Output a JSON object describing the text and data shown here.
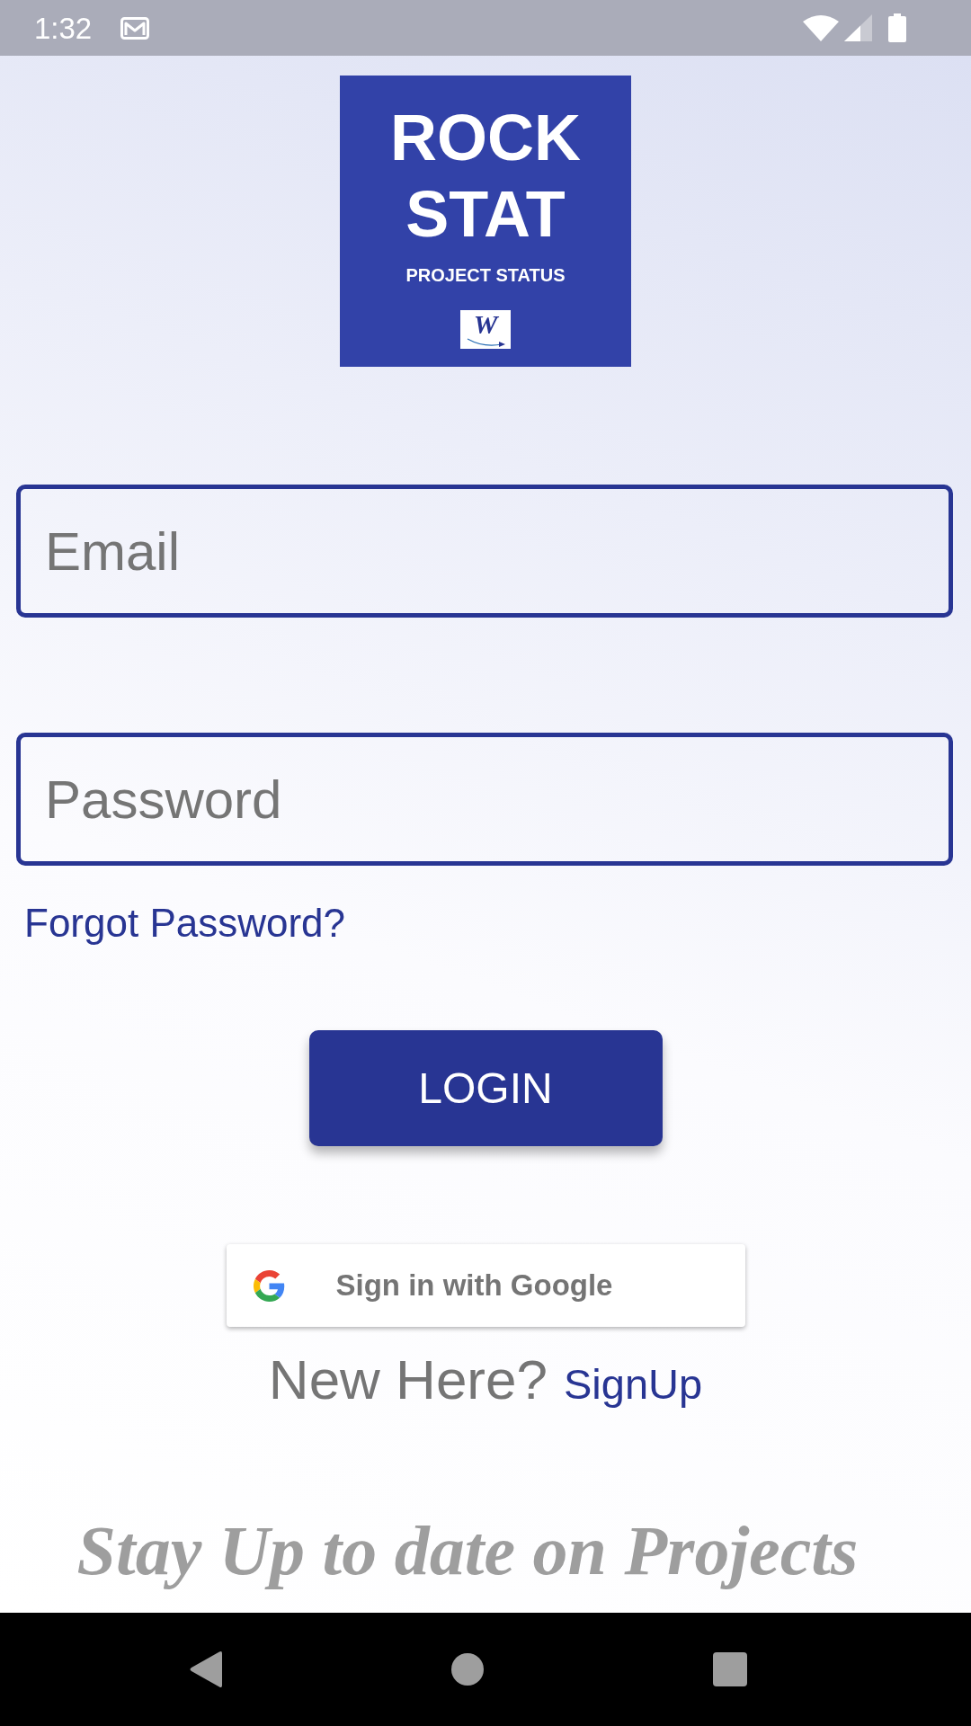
{
  "status_bar": {
    "time": "1:32"
  },
  "logo": {
    "title_lines": [
      "ROCK",
      "STAT"
    ],
    "subtitle": "PROJECT STATUS",
    "mark_letter": "W"
  },
  "fields": [
    {
      "placeholder": "Email"
    },
    {
      "placeholder": "Password"
    }
  ],
  "forgot_link": "Forgot Password?",
  "login_button": "LOGIN",
  "google_button": "Sign in with Google",
  "signup": {
    "prompt": "New Here?",
    "link": "SignUp"
  },
  "tagline": "Stay Up to date on Projects"
}
